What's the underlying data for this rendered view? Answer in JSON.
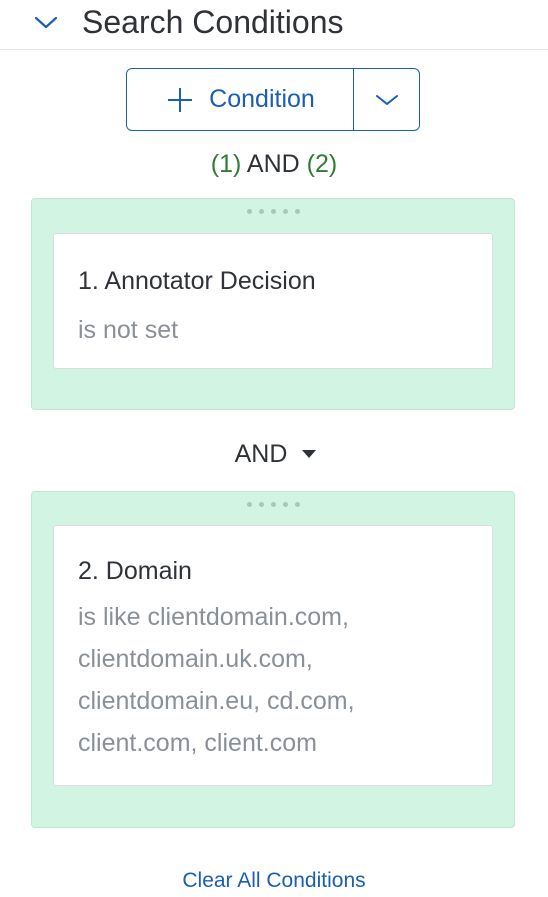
{
  "header": {
    "title": "Search Conditions",
    "collapse_icon": "chevron-down-icon"
  },
  "add_condition": {
    "label": "Condition",
    "add_icon": "plus-icon",
    "dropdown_icon": "chevron-down-icon"
  },
  "expression": {
    "left": "(1)",
    "operator": "AND",
    "right": "(2)"
  },
  "conditions": [
    {
      "title": "1. Annotator Decision",
      "description": "is not set"
    },
    {
      "title": "2. Domain",
      "description_lines": [
        "is like clientdomain.com,",
        "clientdomain.uk.com,",
        "clientdomain.eu, cd.com,",
        "client.com, client.com"
      ]
    }
  ],
  "joiner": {
    "operator": "AND",
    "icon": "caret-down-icon"
  },
  "clear_all_label": "Clear All Conditions",
  "colors": {
    "accent": "#1a5fb4",
    "group_bg": "#d2f5e3",
    "expression_number": "#2e7d32"
  }
}
